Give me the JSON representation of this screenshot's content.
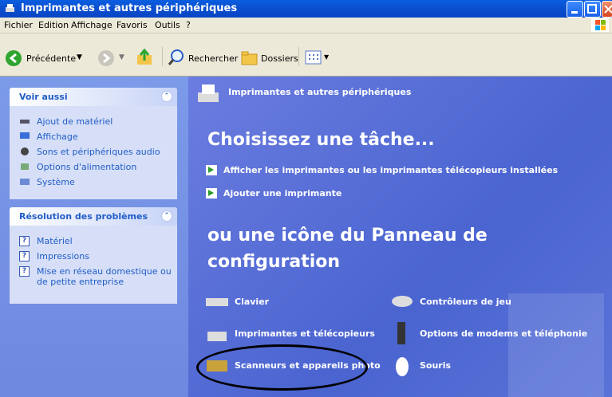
{
  "window": {
    "title": "Imprimantes et autres périphériques"
  },
  "menu": [
    "Fichier",
    "Edition",
    "Affichage",
    "Favoris",
    "Outils",
    "?"
  ],
  "toolbar": {
    "back": "Précédente",
    "search": "Rechercher",
    "folders": "Dossiers"
  },
  "left": {
    "see_also": {
      "title": "Voir aussi",
      "items": [
        "Ajout de matériel",
        "Affichage",
        "Sons et périphériques audio",
        "Options d'alimentation",
        "Système"
      ]
    },
    "troubleshoot": {
      "title": "Résolution des problèmes",
      "items": [
        "Matériel",
        "Impressions",
        "Mise en réseau domestique ou",
        "de petite entreprise"
      ]
    }
  },
  "main": {
    "header": "Imprimantes et autres périphériques",
    "choose_task": "Choisissez une tâche...",
    "tasks": [
      "Afficher les imprimantes ou les imprimantes télécopieurs installées",
      "Ajouter une imprimante"
    ],
    "or_icon_line1": "ou une icône du Panneau de",
    "or_icon_line2": "configuration",
    "icons": [
      "Clavier",
      "Contrôleurs de jeu",
      "Imprimantes et télécopieurs",
      "Options de modems et téléphonie",
      "Scanneurs et appareils photo",
      "Souris"
    ]
  },
  "colors": {
    "title_bar": "#0a4fd0",
    "left_pane": "#7b9ae8",
    "main_pane": "#5a6fd8",
    "link": "#215dc6"
  }
}
